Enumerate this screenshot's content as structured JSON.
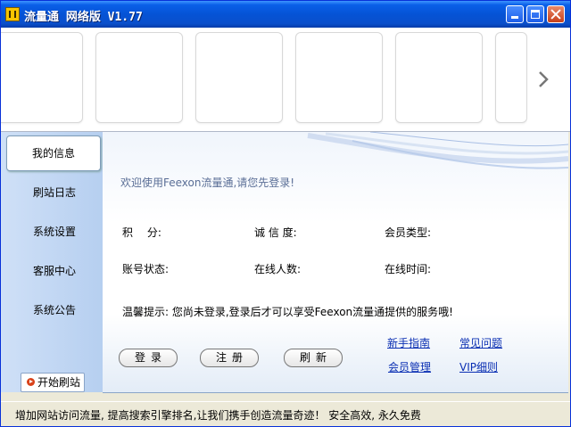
{
  "window": {
    "title": "流量通 网络版 V1.77"
  },
  "sidebar": {
    "items": [
      {
        "label": "我的信息"
      },
      {
        "label": "刷站日志"
      },
      {
        "label": "系统设置"
      },
      {
        "label": "客服中心"
      },
      {
        "label": "系统公告"
      }
    ],
    "start_button": "开始刷站"
  },
  "main": {
    "welcome": "欢迎使用Feexon流量通,请您先登录!",
    "fields": {
      "points": "积　 分:",
      "credit": "诚 信 度:",
      "member_type": "会员类型:",
      "account_status": "账号状态:",
      "online_count": "在线人数:",
      "online_time": "在线时间:"
    },
    "tip": "温馨提示: 您尚未登录,登录后才可以享受Feexon流量通提供的服务哦!",
    "buttons": {
      "login": "登录",
      "register": "注册",
      "refresh": "刷新"
    },
    "links": {
      "guide": "新手指南",
      "faq": "常见问题",
      "member_mgmt": "会员管理",
      "vip": "VIP细则"
    }
  },
  "statusbar": {
    "text": "增加网站访问流量, 提高搜索引擎排名,让我们携手创造流量奇迹！ 安全高效, 永久免费"
  }
}
